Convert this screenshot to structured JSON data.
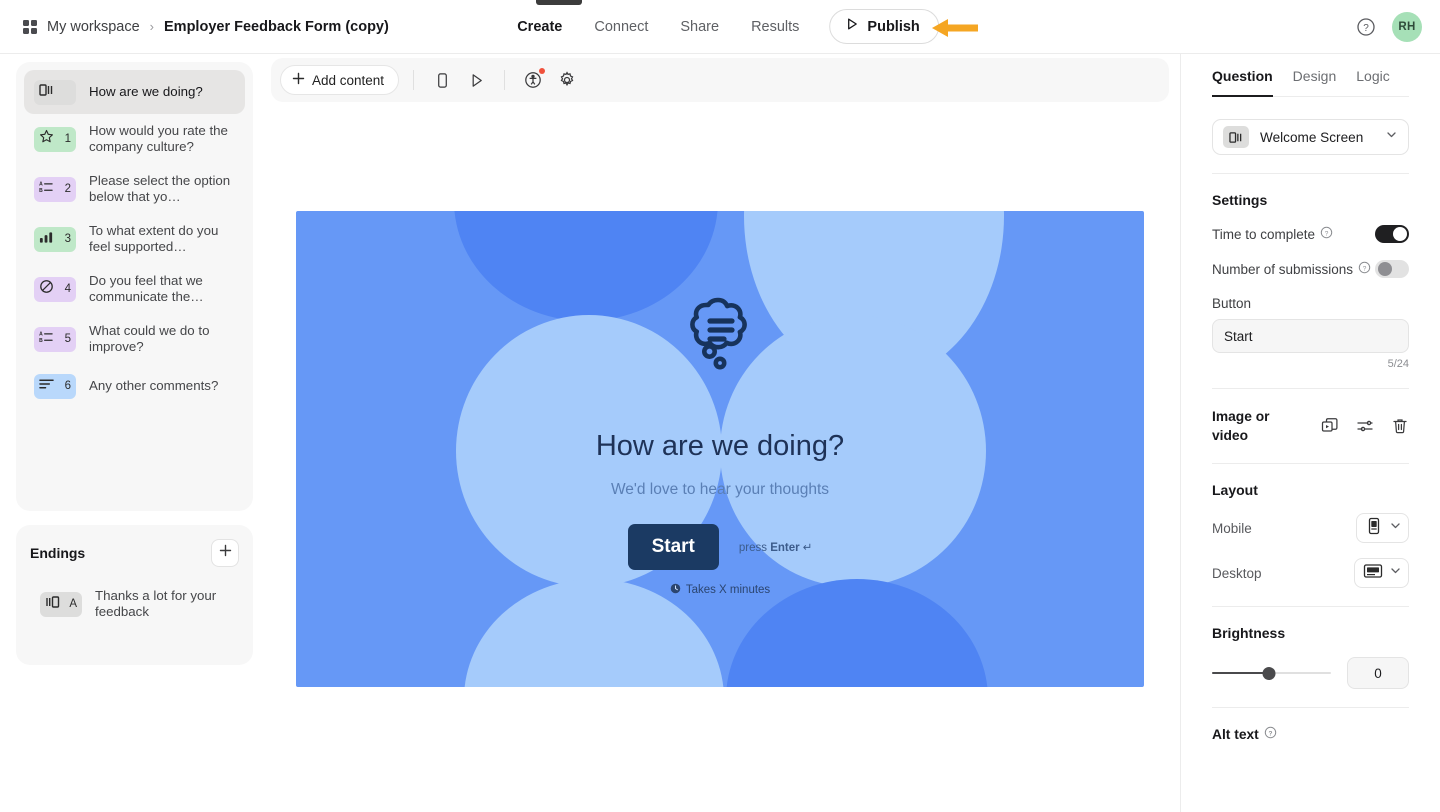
{
  "header": {
    "workspace": "My workspace",
    "separator": "›",
    "form_title": "Employer Feedback Form (copy)",
    "nav": [
      {
        "label": "Create",
        "active": true
      },
      {
        "label": "Connect",
        "active": false
      },
      {
        "label": "Share",
        "active": false
      },
      {
        "label": "Results",
        "active": false
      }
    ],
    "publish_label": "Publish",
    "avatar_initials": "RH"
  },
  "sidebar": {
    "questions": [
      {
        "number": "",
        "label": "How are we doing?",
        "icon": "welcome-screen-icon",
        "color": "bg-grey",
        "selected": true
      },
      {
        "number": "1",
        "label": "How would you rate the company culture?",
        "icon": "star-rating-icon",
        "color": "bg-green",
        "selected": false
      },
      {
        "number": "2",
        "label": "Please select the option below that yo…",
        "icon": "multiple-choice-icon",
        "color": "bg-purple",
        "selected": false
      },
      {
        "number": "3",
        "label": "To what extent do you feel supported…",
        "icon": "ranking-bars-icon",
        "color": "bg-green",
        "selected": false
      },
      {
        "number": "4",
        "label": "Do you feel that we communicate the…",
        "icon": "no-entry-icon",
        "color": "bg-purple",
        "selected": false
      },
      {
        "number": "5",
        "label": "What could we do to improve?",
        "icon": "multiple-choice-icon",
        "color": "bg-purple",
        "selected": false
      },
      {
        "number": "6",
        "label": "Any other comments?",
        "icon": "long-text-icon",
        "color": "bg-blue",
        "selected": false
      }
    ],
    "endings_title": "Endings",
    "endings": [
      {
        "number": "A",
        "label": "Thanks a lot for your feedback",
        "icon": "ending-screen-icon",
        "color": "bg-grey"
      }
    ]
  },
  "toolbar": {
    "add_content_label": "Add content",
    "icons": [
      {
        "name": "mobile-preview-icon",
        "badge": false
      },
      {
        "name": "play-preview-icon",
        "badge": false
      },
      {
        "name": "accessibility-icon",
        "badge": true
      },
      {
        "name": "settings-gear-icon",
        "badge": false
      }
    ]
  },
  "stage": {
    "title": "How are we doing?",
    "subtitle": "We'd love to hear your thoughts",
    "start_button": "Start",
    "press_enter_prefix": "press ",
    "press_enter_key": "Enter",
    "press_enter_symbol": "↵",
    "takes_text": "Takes X minutes",
    "colors": {
      "base": "#6698f6",
      "dark_blob": "#4f84f3",
      "light_blob": "#a5cbfb",
      "title": "#1e3257",
      "subtitle": "#5a7fb5",
      "button_bg": "#1b3a63"
    }
  },
  "right_panel": {
    "tabs": [
      {
        "label": "Question",
        "active": true
      },
      {
        "label": "Design",
        "active": false
      },
      {
        "label": "Logic",
        "active": false
      }
    ],
    "type_select": "Welcome Screen",
    "settings_title": "Settings",
    "time_to_complete_label": "Time to complete",
    "time_to_complete_on": true,
    "number_of_submissions_label": "Number of submissions",
    "number_of_submissions_on": false,
    "button_label": "Button",
    "button_value": "Start",
    "button_counter": "5/24",
    "image_or_video_label": "Image or video",
    "image_actions": [
      "replace-media-icon",
      "adjust-media-icon",
      "delete-media-icon"
    ],
    "layout_title": "Layout",
    "mobile_label": "Mobile",
    "desktop_label": "Desktop",
    "brightness_title": "Brightness",
    "brightness_value": "0",
    "alt_text_label": "Alt text"
  }
}
